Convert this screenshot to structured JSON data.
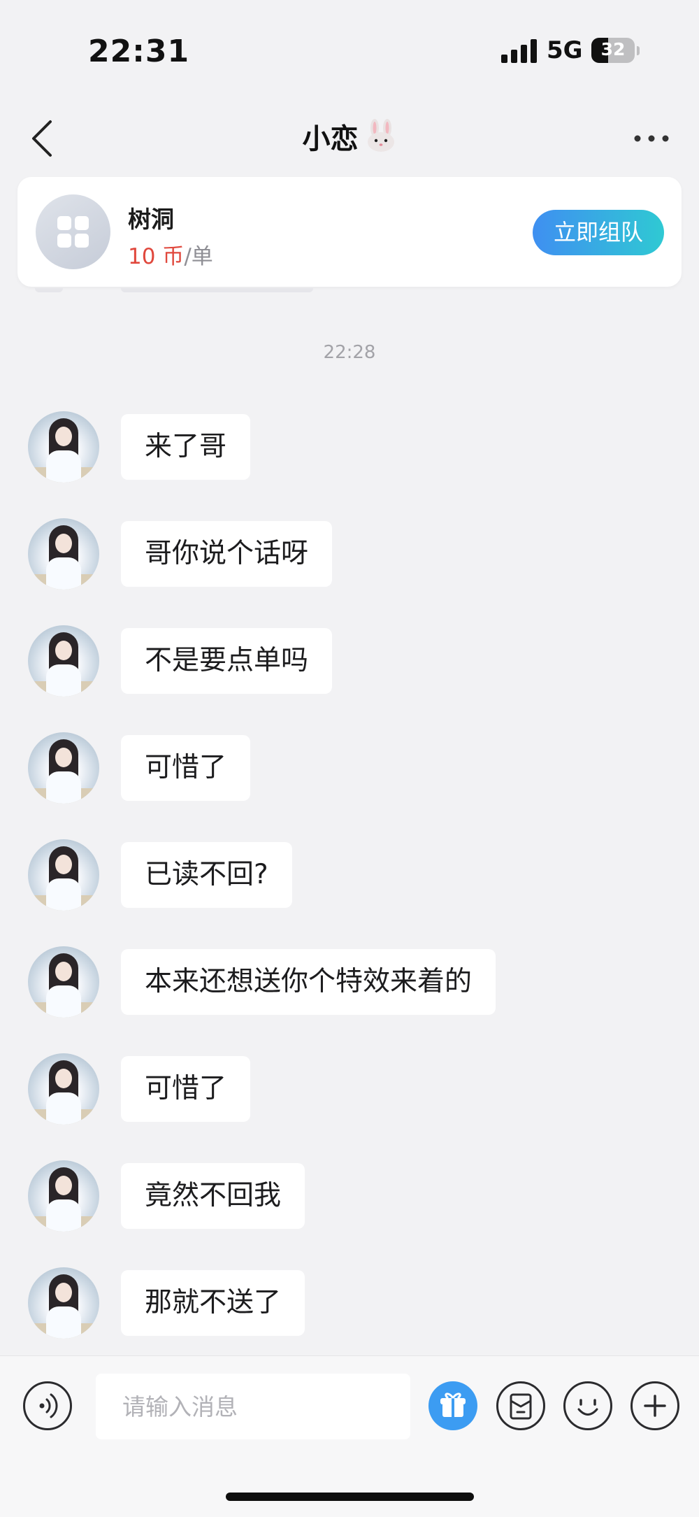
{
  "status_bar": {
    "time": "22:31",
    "network": "5G",
    "battery": "32"
  },
  "header": {
    "title": "小恋",
    "icons": [
      "back-arrow-icon",
      "bunny-emoji-icon",
      "more-dots-icon"
    ]
  },
  "service_card": {
    "name": "树洞",
    "price_value": "10 币",
    "price_unit": "/单",
    "action_label": "立即组队",
    "colors": {
      "price": "#e0483d",
      "button_start": "#3f8ff1",
      "button_end": "#2fc9d3"
    }
  },
  "chat": {
    "timestamp": "22:28",
    "messages": [
      {
        "text": "来了哥"
      },
      {
        "text": "哥你说个话呀"
      },
      {
        "text": "不是要点单吗"
      },
      {
        "text": "可惜了"
      },
      {
        "text": "已读不回?"
      },
      {
        "text": "本来还想送你个特效来着的"
      },
      {
        "text": "可惜了"
      },
      {
        "text": "竟然不回我"
      },
      {
        "text": "那就不送了"
      }
    ]
  },
  "input_bar": {
    "placeholder": "请输入消息",
    "icons": [
      "voice-icon",
      "gift-icon",
      "red-packet-icon",
      "emoji-icon",
      "plus-icon"
    ],
    "gift_color": "#3c9cf2"
  }
}
